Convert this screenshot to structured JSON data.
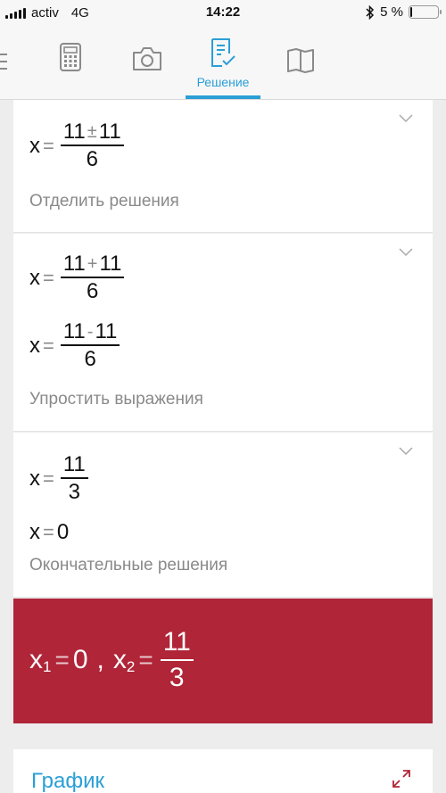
{
  "status": {
    "carrier": "activ",
    "network": "4G",
    "time": "14:22",
    "battery_text": "5 %",
    "battery_level": 0.05,
    "bluetooth_icon": "bluetooth-icon"
  },
  "toolbar": {
    "tabs": [
      {
        "icon": "calculator-icon"
      },
      {
        "icon": "camera-icon"
      },
      {
        "icon": "solution-icon",
        "label": "Решение",
        "active": true
      },
      {
        "icon": "book-icon"
      }
    ],
    "active_label": "Решение",
    "accent_color": "#2a9fd6"
  },
  "steps": [
    {
      "equation": {
        "var": "x",
        "eq": "=",
        "num_left": "11",
        "op": "±",
        "num_right": "11",
        "den": "6"
      },
      "caption": "Отделить решения"
    },
    {
      "equations": [
        {
          "var": "x",
          "eq": "=",
          "num_left": "11",
          "op": "+",
          "num_right": "11",
          "den": "6"
        },
        {
          "var": "x",
          "eq": "=",
          "num_left": "11",
          "op": "-",
          "num_right": "11",
          "den": "6"
        }
      ],
      "caption": "Упростить выражения"
    },
    {
      "equations": [
        {
          "var": "x",
          "eq": "=",
          "num": "11",
          "den": "3"
        },
        {
          "var": "x",
          "eq": "=",
          "value": "0"
        }
      ],
      "caption": "Окончательные решения"
    }
  ],
  "result": {
    "x1_var": "x",
    "x1_sub": "1",
    "x1_eq": "=",
    "x1_value": "0",
    "separator": ",",
    "x2_var": "x",
    "x2_sub": "2",
    "x2_eq": "=",
    "x2_num": "11",
    "x2_den": "3",
    "background_color": "#b02538"
  },
  "graph": {
    "title": "График"
  }
}
